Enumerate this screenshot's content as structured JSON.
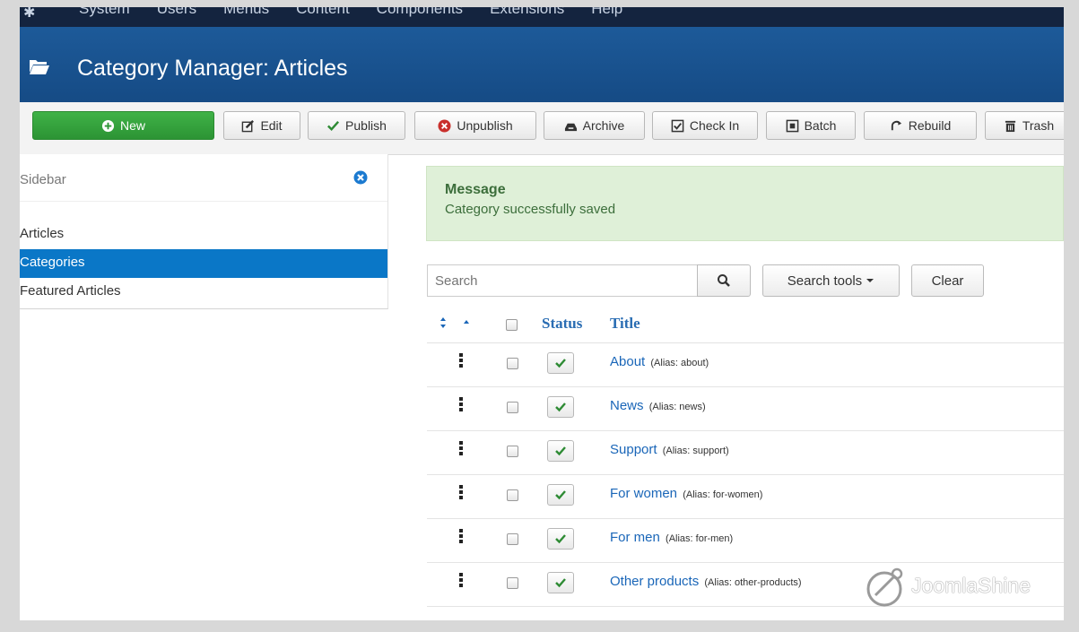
{
  "topnav": {
    "items": [
      "System",
      "Users",
      "Menus",
      "Content",
      "Components",
      "Extensions",
      "Help"
    ]
  },
  "header": {
    "title": "Category Manager: Articles"
  },
  "toolbar": {
    "new": "New",
    "edit": "Edit",
    "publish": "Publish",
    "unpublish": "Unpublish",
    "archive": "Archive",
    "checkin": "Check In",
    "batch": "Batch",
    "rebuild": "Rebuild",
    "trash": "Trash"
  },
  "sidebar": {
    "title": "Sidebar",
    "items": [
      {
        "label": "Articles",
        "active": false
      },
      {
        "label": "Categories",
        "active": true
      },
      {
        "label": "Featured Articles",
        "active": false
      }
    ]
  },
  "message": {
    "heading": "Message",
    "text": "Category successfully saved"
  },
  "search": {
    "placeholder": "Search",
    "tools_label": "Search tools",
    "clear_label": "Clear"
  },
  "table": {
    "headers": {
      "status": "Status",
      "title": "Title"
    },
    "rows": [
      {
        "title": "About",
        "alias": "(Alias: about)",
        "published": true
      },
      {
        "title": "News",
        "alias": "(Alias: news)",
        "published": true
      },
      {
        "title": "Support",
        "alias": "(Alias: support)",
        "published": true
      },
      {
        "title": "For women",
        "alias": "(Alias: for-women)",
        "published": true
      },
      {
        "title": "For men",
        "alias": "(Alias: for-men)",
        "published": true
      },
      {
        "title": "Other products",
        "alias": "(Alias: other-products)",
        "published": true
      }
    ]
  },
  "watermark": {
    "text": "JoomlaShine"
  },
  "colors": {
    "header_blue": "#1d5a99",
    "nav_dark": "#14243f",
    "new_green": "#3fb247",
    "active_blue": "#0a77c7",
    "message_bg": "#dff0d8",
    "link_blue": "#1a66b8"
  }
}
